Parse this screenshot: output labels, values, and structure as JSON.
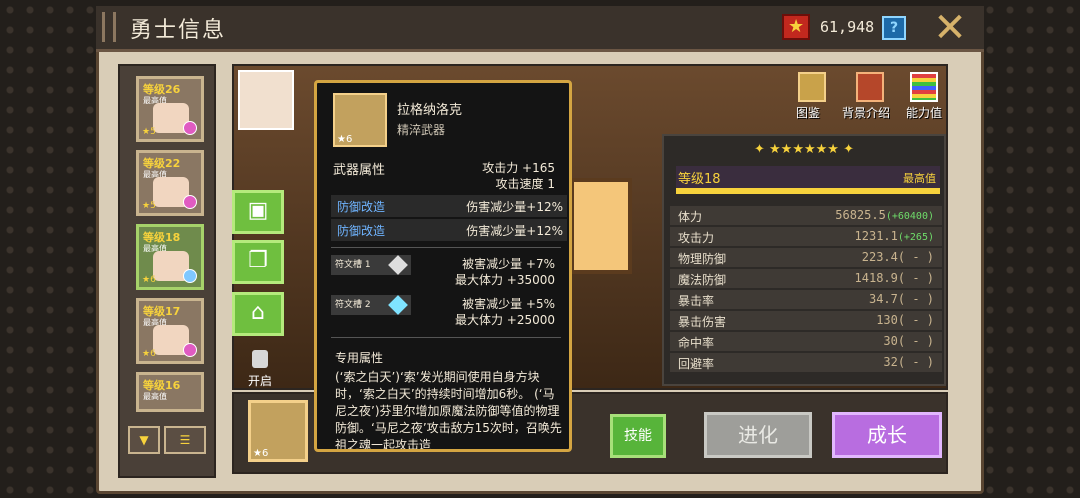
{
  "header": {
    "title": "勇士信息",
    "currency_value": "61,948",
    "help_label": "?",
    "close_label": "✕"
  },
  "heroes": [
    {
      "level": "等级26",
      "max": "最高值",
      "stars": "★5"
    },
    {
      "level": "等级22",
      "max": "最高值",
      "stars": "★5"
    },
    {
      "level": "等级18",
      "max": "最高值",
      "stars": "★6"
    },
    {
      "level": "等级17",
      "max": "最高值",
      "stars": "★6"
    },
    {
      "level": "等级16",
      "max": "最高值",
      "stars": "★5"
    }
  ],
  "top_tabs": {
    "codex": "图鉴",
    "background": "背景介绍",
    "stats": "能力值"
  },
  "side": {
    "open_label": "开启"
  },
  "stats_panel": {
    "stars": "✦ ★★★★★★ ✦",
    "level": "等级18",
    "max": "最高值",
    "rows": [
      {
        "name": "体力",
        "value": "56825.5",
        "bonus": "(+60400)"
      },
      {
        "name": "攻击力",
        "value": "1231.1",
        "bonus": "(+265)"
      },
      {
        "name": "物理防御",
        "value": "223.4",
        "bonus": "( - )"
      },
      {
        "name": "魔法防御",
        "value": "1418.9",
        "bonus": "( - )"
      },
      {
        "name": "暴击率",
        "value": "34.7",
        "bonus": "( - )"
      },
      {
        "name": "暴击伤害",
        "value": "130",
        "bonus": "( - )"
      },
      {
        "name": "命中率",
        "value": "30",
        "bonus": "( - )"
      },
      {
        "name": "回避率",
        "value": "32",
        "bonus": "( - )"
      }
    ]
  },
  "weapon_slot_stars": "★6",
  "buttons": {
    "skill": "技能",
    "evolve": "进化",
    "grow": "成长"
  },
  "popup": {
    "name": "拉格纳洛克",
    "subtitle": "精淬武器",
    "icon_stars": "★6",
    "weapon_attr_title": "武器属性",
    "attack": "攻击力 +165",
    "speed": "攻击速度 1",
    "mods": [
      {
        "label": "防御改造",
        "value": "伤害减少量+12%"
      },
      {
        "label": "防御改造",
        "value": "伤害减少量+12%"
      }
    ],
    "rune1": {
      "label": "符文槽 1",
      "line1": "被害减少量 +7%",
      "line2": "最大体力 +35000"
    },
    "rune2": {
      "label": "符文槽 2",
      "line1": "被害减少量 +5%",
      "line2": "最大体力 +25000"
    },
    "special_title": "专用属性",
    "special_desc": "(‘索之白天’)‘索’发光期间使用自身方块时，‘索之白天’的持续时间增加6秒。 (‘马尼之夜’)芬里尔增加原魔法防御等值的物理防御。‘马尼之夜’攻击敌方15次时，召唤先祖之魂一起攻击造"
  }
}
